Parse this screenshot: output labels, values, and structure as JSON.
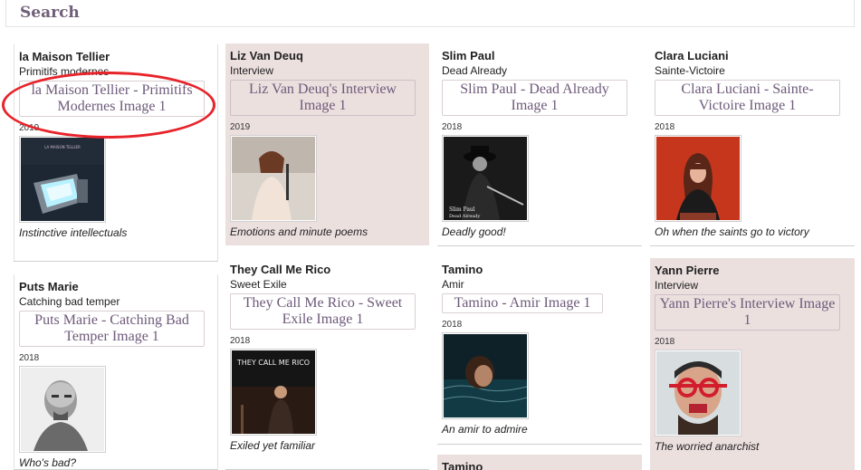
{
  "search": {
    "label": "Search"
  },
  "cards": [
    {
      "artist": "la Maison Tellier",
      "album": "Primitifs modernes",
      "image_title": "la Maison Tellier - Primitifs Modernes Image 1",
      "year": "2019",
      "description": "Instinctive intellectuals",
      "cover_icon": "tv-album-cover"
    },
    {
      "artist": "Liz Van Deuq",
      "album": "Interview",
      "image_title": "Liz Van Deuq's Interview Image 1",
      "year": "2019",
      "description": "Emotions and minute poems",
      "cover_icon": "singer-photo"
    },
    {
      "artist": "Slim Paul",
      "album": "Dead Already",
      "image_title": "Slim Paul - Dead Already Image 1",
      "year": "2018",
      "description": "Deadly good!",
      "cover_icon": "guitarist-cover",
      "cover_text": "Slim Paul",
      "cover_subtext": "Dead Already"
    },
    {
      "artist": "Clara Luciani",
      "album": "Sainte-Victoire",
      "image_title": "Clara Luciani - Sainte-Victoire Image 1",
      "year": "2018",
      "description": "Oh when the saints go to victory",
      "cover_icon": "red-portrait-cover"
    },
    {
      "artist": "Puts Marie",
      "album": "Catching bad temper",
      "image_title": "Puts Marie - Catching Bad Temper Image 1",
      "year": "2018",
      "description": "Who's bad?",
      "cover_icon": "bw-portrait-cover"
    },
    {
      "artist": "They Call Me Rico",
      "album": "Sweet Exile",
      "image_title": "They Call Me Rico - Sweet Exile Image 1",
      "year": "2018",
      "description": "Exiled yet familiar",
      "cover_icon": "rico-cover",
      "cover_text": "THEY CALL ME RICO"
    },
    {
      "artist": "Tamino",
      "album": "Amir",
      "image_title": "Tamino - Amir Image 1",
      "year": "2018",
      "description": "An amir to admire",
      "cover_icon": "water-portrait-cover"
    },
    {
      "artist": "Yann Pierre",
      "album": "Interview",
      "image_title": "Yann Pierre's Interview Image 1",
      "year": "2018",
      "description": "The worried anarchist",
      "cover_icon": "glasses-portrait"
    },
    {
      "artist": "Tamino"
    }
  ]
}
